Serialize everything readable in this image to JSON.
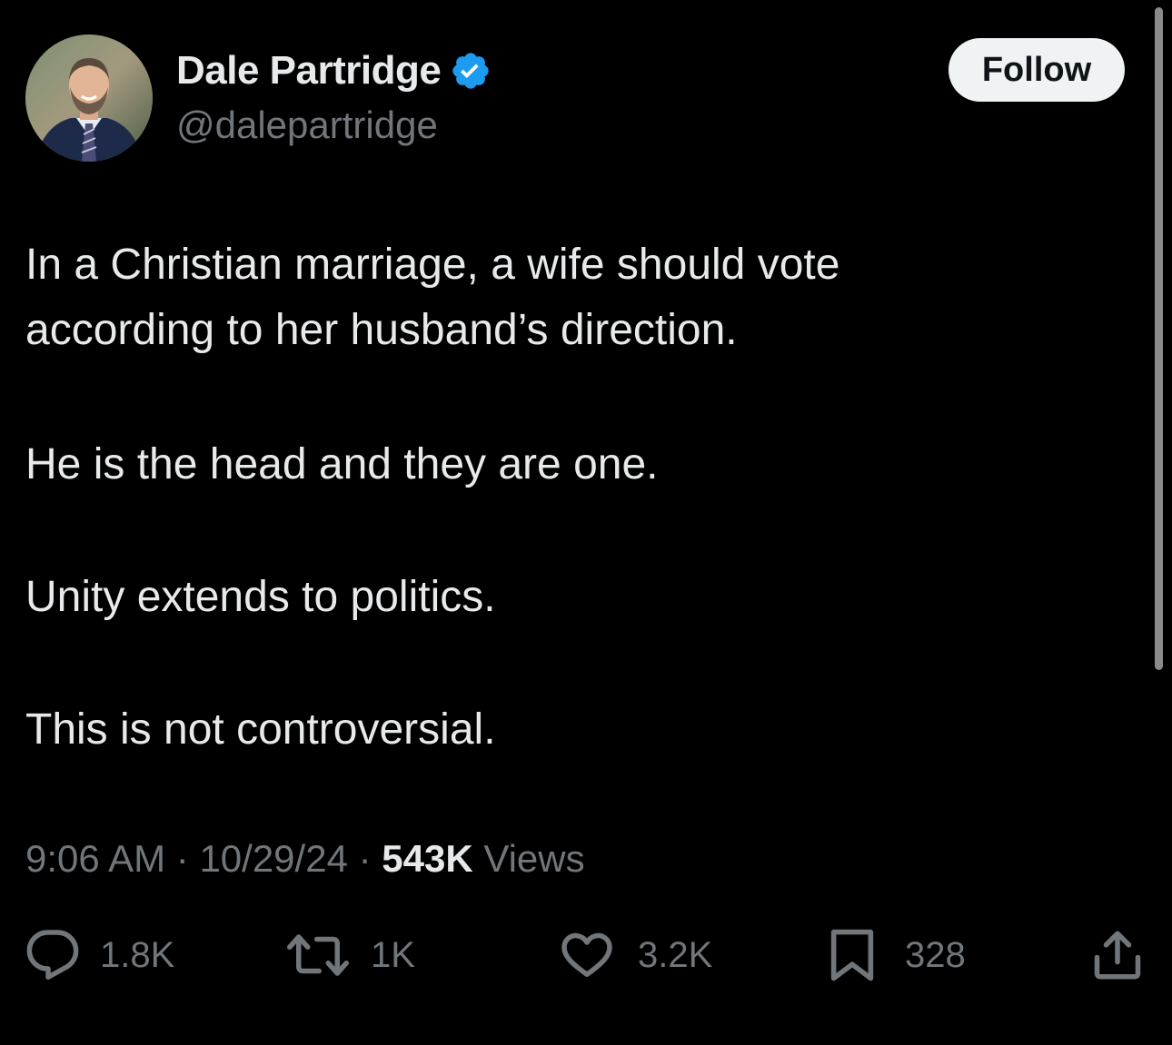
{
  "author": {
    "display_name": "Dale Partridge",
    "handle": "@dalepartridge",
    "verified": true,
    "verified_color": "#1d9bf0"
  },
  "follow_label": "Follow",
  "tweet": {
    "lines": [
      "In a Christian marriage, a wife should vote",
      "according to her husband’s direction.",
      "He is the head and they are one.",
      "Unity extends to politics.",
      "This is not controversial."
    ]
  },
  "meta": {
    "time": "9:06 AM",
    "separator": "·",
    "date": "10/29/24",
    "views_count": "543K",
    "views_label": "Views"
  },
  "actions": {
    "reply": {
      "icon": "reply-icon",
      "count": "1.8K"
    },
    "repost": {
      "icon": "repost-icon",
      "count": "1K"
    },
    "like": {
      "icon": "heart-icon",
      "count": "3.2K"
    },
    "bookmark": {
      "icon": "bookmark-icon",
      "count": "328"
    },
    "share": {
      "icon": "share-icon"
    }
  },
  "colors": {
    "background": "#000000",
    "text": "#e7e9ea",
    "secondary": "#71767b",
    "follow_bg": "#eff3f4"
  }
}
